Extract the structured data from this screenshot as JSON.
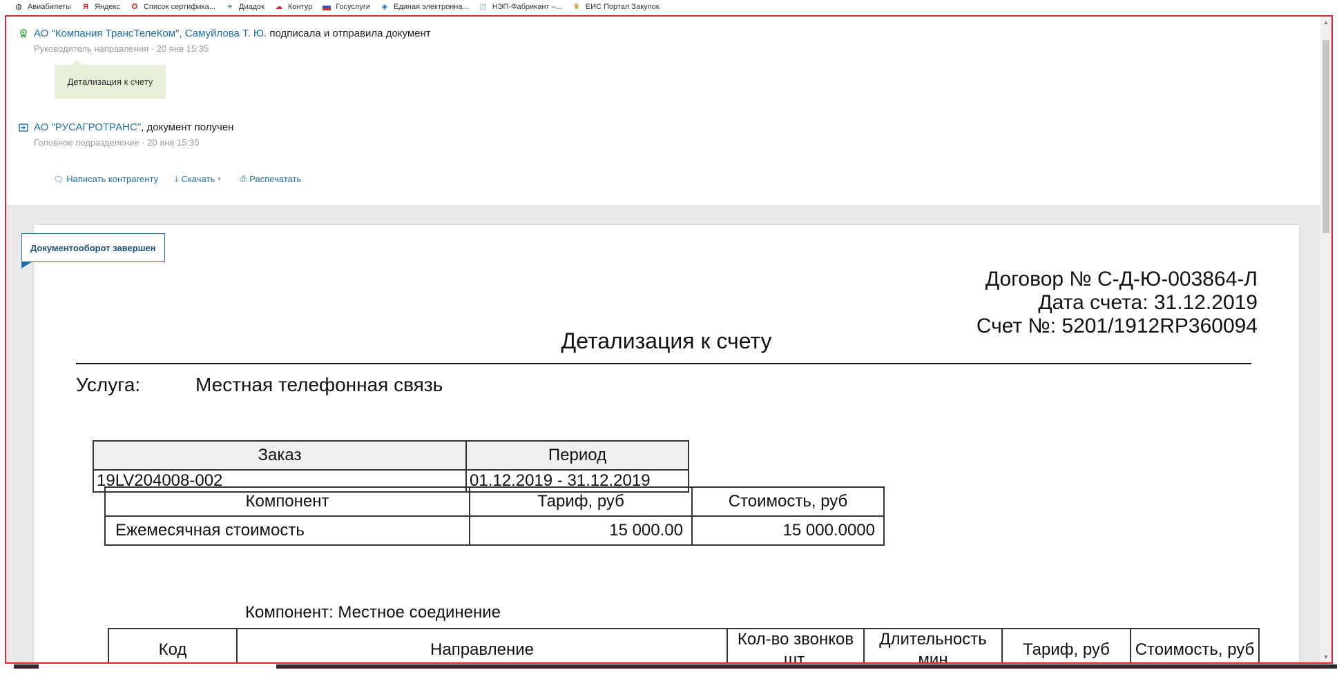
{
  "bookmarks": [
    {
      "label": "Авиабилеты",
      "icon": "globe-icon"
    },
    {
      "label": "Яндекс",
      "icon": "yandex-icon"
    },
    {
      "label": "Список сертифика...",
      "icon": "certificate-icon"
    },
    {
      "label": "Диадок",
      "icon": "diadoc-icon"
    },
    {
      "label": "Контур",
      "icon": "cloud-icon"
    },
    {
      "label": "Госуслуги",
      "icon": "flag-icon"
    },
    {
      "label": "Единая электронна...",
      "icon": "diamond-icon"
    },
    {
      "label": "НЭП-Фабрикант –...",
      "icon": "box-icon"
    },
    {
      "label": "ЕИС Портал Закупок",
      "icon": "emblem-icon"
    }
  ],
  "events": [
    {
      "org": "АО \"Компания ТрансТелеКом\", Самуйлова Т. Ю.",
      "action": " подписала и отправила документ",
      "role": "Руководитель направления",
      "time": "20 янв 15:35",
      "icon": "signer-icon"
    },
    {
      "org": "АО \"РУСАГРОТРАНС\"",
      "action": ", документ получен",
      "role": "Головное подразделение",
      "time": "20 янв 15:35",
      "icon": "received-icon"
    }
  ],
  "separator": "·",
  "comment_bubble": "Детализация к счету",
  "actions": {
    "write": "Написать контрагенту",
    "download": "Скачать",
    "print": "Распечатать"
  },
  "status_tag": "Документооборот завершен",
  "document": {
    "contract": "Договор № С-Д-Ю-003864-Л",
    "invoice_date": "Дата счета: 31.12.2019",
    "invoice_no": "Счет №: 5201/1912RP360094",
    "title": "Детализация к счету",
    "service_label": "Услуга:",
    "service_value": "Местная телефонная связь",
    "order_table": {
      "headers": [
        "Заказ",
        "Период"
      ],
      "row": [
        "19LV204008-002",
        "01.12.2019 - 31.12.2019"
      ]
    },
    "component_table": {
      "headers": [
        "Компонент",
        "Тариф, руб",
        "Стоимость, руб"
      ],
      "row": [
        "Ежемесячная стоимость",
        "15 000.00",
        "15 000.0000"
      ]
    },
    "component_label": "Компонент: Местное соединение",
    "calls_table": {
      "headers": [
        "Код",
        "Направление",
        "Кол-во звонков шт.",
        "Длительность мин",
        "Тариф, руб",
        "Стоимость, руб"
      ]
    }
  },
  "colors": {
    "frame_border": "#e0262b",
    "link": "#1a6ea8",
    "bubble_bg": "#e7f0d8",
    "page_gray": "#e9e9e9"
  }
}
